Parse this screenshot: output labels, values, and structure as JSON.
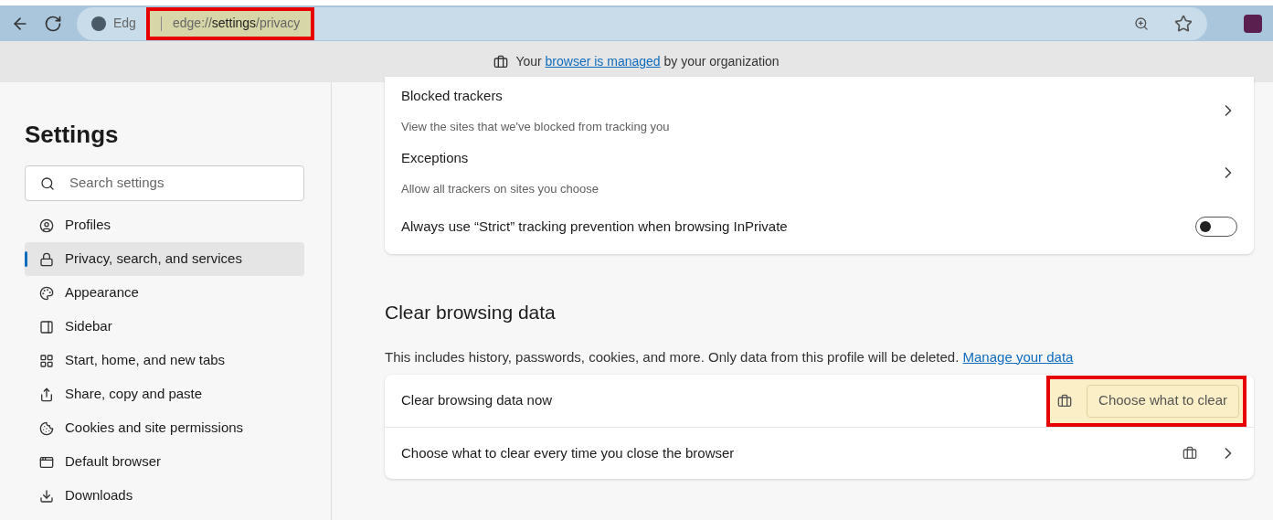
{
  "toolbar": {
    "site_label": "Edg",
    "url": {
      "prefix": "edge://",
      "host": "settings",
      "path": "/privacy",
      "highlighted": true
    }
  },
  "banner": {
    "before": "Your",
    "link": "browser is managed",
    "after": "by your organization"
  },
  "sidebar": {
    "title": "Settings",
    "search": {
      "placeholder": "Search settings"
    },
    "items": [
      {
        "label": "Profiles",
        "selected": false
      },
      {
        "label": "Privacy, search, and services",
        "selected": true
      },
      {
        "label": "Appearance",
        "selected": false
      },
      {
        "label": "Sidebar",
        "selected": false
      },
      {
        "label": "Start, home, and new tabs",
        "selected": false
      },
      {
        "label": "Share, copy and paste",
        "selected": false
      },
      {
        "label": "Cookies and site permissions",
        "selected": false
      },
      {
        "label": "Default browser",
        "selected": false
      },
      {
        "label": "Downloads",
        "selected": false
      }
    ]
  },
  "tracking_card": {
    "rows": [
      {
        "kind": "link",
        "title": "Blocked trackers",
        "description": "View the sites that we've blocked from tracking you"
      },
      {
        "kind": "link",
        "title": "Exceptions",
        "description": "Allow all trackers on sites you choose"
      },
      {
        "kind": "toggle",
        "title": "Always use “Strict” tracking prevention when browsing InPrivate",
        "on": false
      }
    ]
  },
  "clear_section": {
    "heading": "Clear browsing data",
    "description": "This includes history, passwords, cookies, and more. Only data from this profile will be deleted.",
    "link": "Manage your data",
    "rows": [
      {
        "kind": "button",
        "title": "Clear browsing data now",
        "managed": true,
        "button": "Choose what to clear",
        "highlighted": true
      },
      {
        "kind": "link",
        "title": "Choose what to clear every time you close the browser",
        "managed": true
      }
    ]
  }
}
